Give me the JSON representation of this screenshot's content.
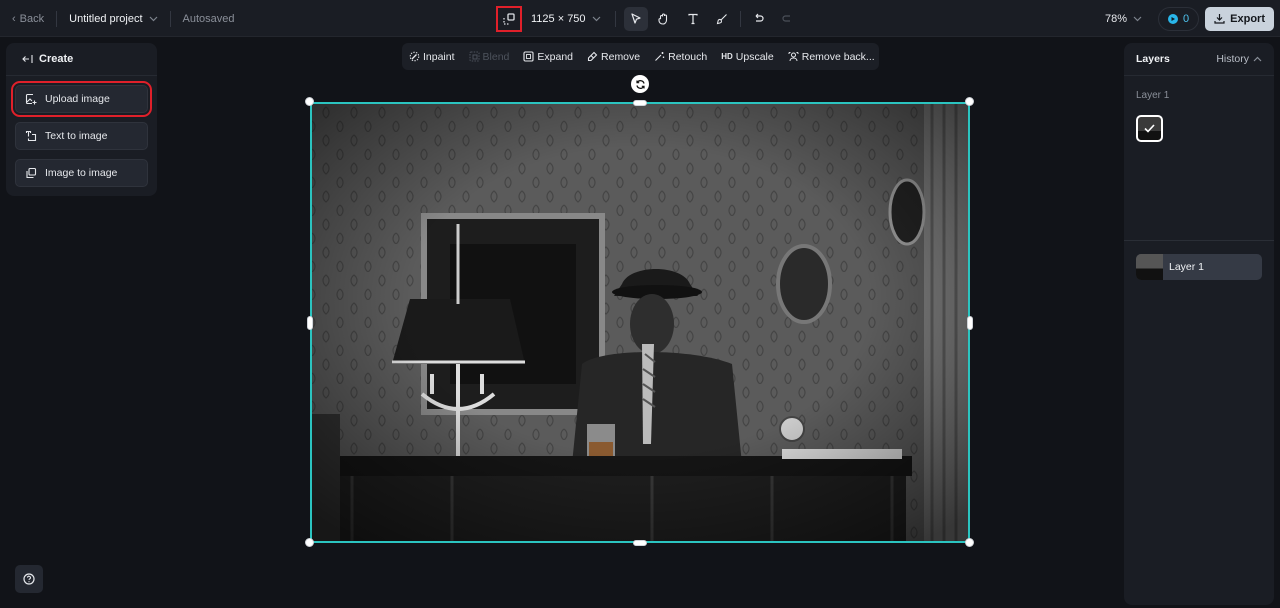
{
  "topbar": {
    "back_label": "Back",
    "project_name": "Untitled project",
    "save_status": "Autosaved",
    "canvas_size": "1125 × 750",
    "zoom_level": "78%",
    "credits": "0",
    "export_label": "Export",
    "tools": [
      {
        "name": "resize-canvas",
        "icon": "resize-icon",
        "highlighted": true
      },
      {
        "name": "select",
        "icon": "pointer-icon",
        "active": true
      },
      {
        "name": "hand",
        "icon": "hand-icon"
      },
      {
        "name": "text",
        "icon": "text-icon"
      },
      {
        "name": "brush",
        "icon": "brush-icon"
      },
      {
        "name": "undo",
        "icon": "undo-icon"
      },
      {
        "name": "redo",
        "icon": "redo-icon",
        "disabled": true
      }
    ]
  },
  "left_panel": {
    "title": "Create",
    "buttons": [
      {
        "label": "Upload image",
        "icon": "upload-image-icon",
        "highlighted": true
      },
      {
        "label": "Text to image",
        "icon": "text-to-image-icon"
      },
      {
        "label": "Image to image",
        "icon": "image-to-image-icon"
      }
    ]
  },
  "ai_toolbar": {
    "items": [
      {
        "label": "Inpaint",
        "icon": "inpaint-icon"
      },
      {
        "label": "Blend",
        "icon": "blend-icon",
        "disabled": true
      },
      {
        "label": "Expand",
        "icon": "expand-icon"
      },
      {
        "label": "Remove",
        "icon": "eraser-icon"
      },
      {
        "label": "Retouch",
        "icon": "magic-wand-icon"
      },
      {
        "label": "Upscale",
        "icon": "hd-icon",
        "badge": "HD"
      },
      {
        "label": "Remove back...",
        "icon": "remove-background-icon"
      }
    ]
  },
  "right_panel": {
    "title": "Layers",
    "history_label": "History",
    "section_label": "Layer 1",
    "layers": [
      {
        "label": "Layer 1",
        "selected": true
      }
    ]
  },
  "canvas": {
    "image_description": "Black and white photo of a man in a fedora and suit seated at a desk with a lamp and glass",
    "selection_color": "#2bc4c0"
  },
  "colors": {
    "highlight": "#e0202a",
    "accent": "#29b6ea"
  }
}
